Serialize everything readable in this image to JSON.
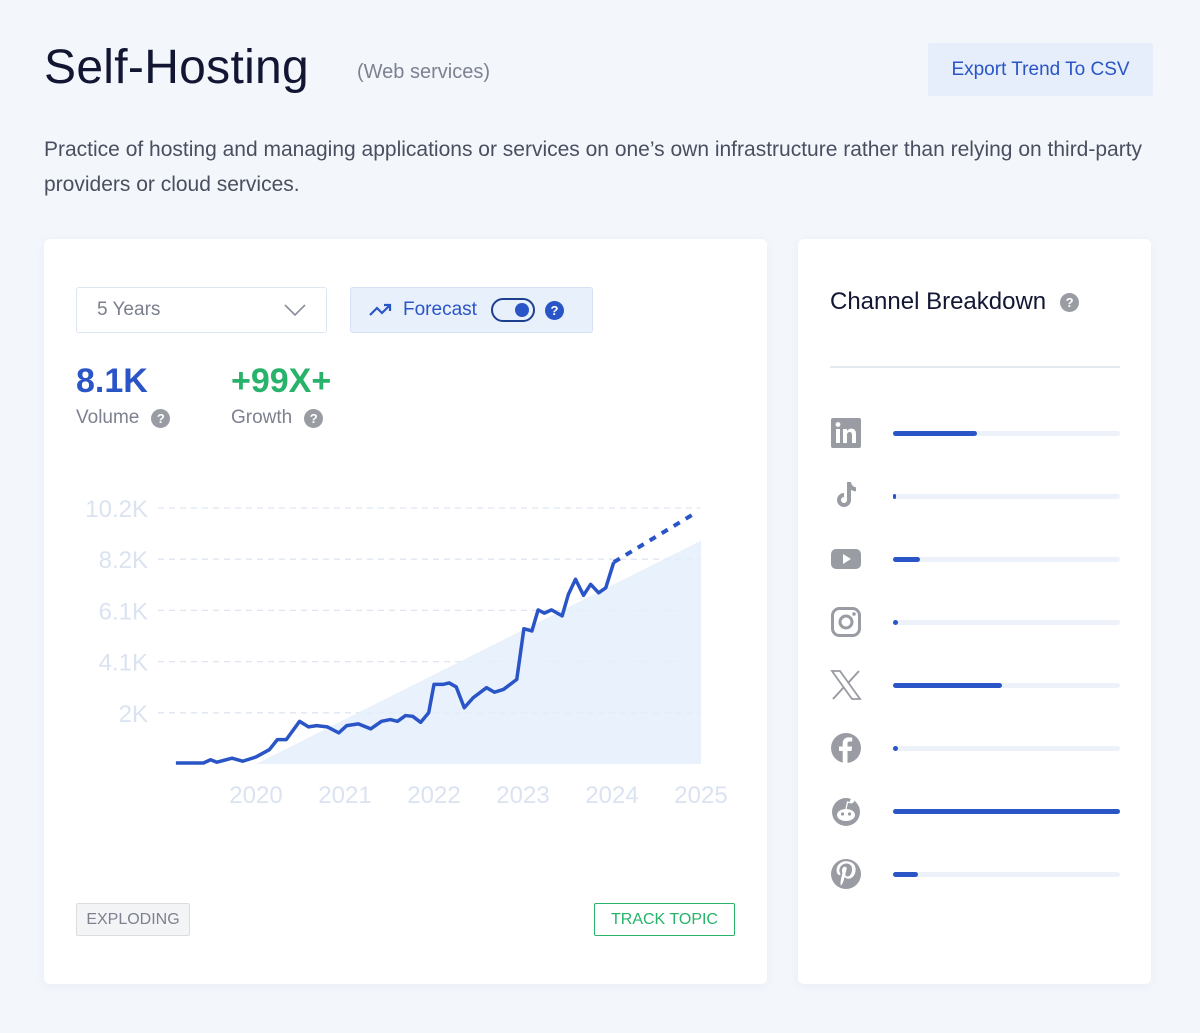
{
  "header": {
    "title": "Self-Hosting",
    "category": "(Web services)",
    "export_label": "Export Trend To CSV",
    "description": "Practice of hosting and managing applications or services on one’s own infrastructure rather than relying on third-party providers or cloud services."
  },
  "controls": {
    "range_value": "5 Years",
    "forecast_label": "Forecast",
    "forecast_on": true
  },
  "metrics": {
    "volume_value": "8.1K",
    "volume_label": "Volume",
    "growth_value": "+99X+",
    "growth_label": "Growth"
  },
  "badges": {
    "status": "EXPLODING",
    "track_label": "TRACK TOPIC"
  },
  "colors": {
    "accent": "#2a55c6",
    "growth": "#27b36a",
    "trend_fill": "#e4eefb"
  },
  "chart_data": {
    "type": "line",
    "x_ticks": [
      "2020",
      "2021",
      "2022",
      "2023",
      "2024",
      "2025"
    ],
    "y_ticks": [
      {
        "value": 2040,
        "label": "2K"
      },
      {
        "value": 4080,
        "label": "4.1K"
      },
      {
        "value": 6120,
        "label": "6.1K"
      },
      {
        "value": 8160,
        "label": "8.2K"
      },
      {
        "value": 10200,
        "label": "10.2K"
      }
    ],
    "xlim": [
      2019.1,
      2025
    ],
    "ylim": [
      0,
      10200
    ],
    "grid": "horizontal-dashed",
    "series": [
      {
        "style": "solid",
        "points": [
          [
            2019.1,
            40
          ],
          [
            2019.41,
            40
          ],
          [
            2019.49,
            170
          ],
          [
            2019.56,
            70
          ],
          [
            2019.73,
            230
          ],
          [
            2019.85,
            110
          ],
          [
            2020.0,
            280
          ],
          [
            2020.15,
            570
          ],
          [
            2020.24,
            970
          ],
          [
            2020.34,
            970
          ],
          [
            2020.49,
            1700
          ],
          [
            2020.59,
            1480
          ],
          [
            2020.68,
            1530
          ],
          [
            2020.8,
            1480
          ],
          [
            2020.93,
            1240
          ],
          [
            2021.02,
            1530
          ],
          [
            2021.15,
            1600
          ],
          [
            2021.29,
            1400
          ],
          [
            2021.41,
            1700
          ],
          [
            2021.51,
            1770
          ],
          [
            2021.59,
            1700
          ],
          [
            2021.68,
            1930
          ],
          [
            2021.76,
            1900
          ],
          [
            2021.85,
            1660
          ],
          [
            2021.94,
            2040
          ],
          [
            2022.0,
            3170
          ],
          [
            2022.1,
            3170
          ],
          [
            2022.17,
            3230
          ],
          [
            2022.25,
            3070
          ],
          [
            2022.34,
            2240
          ],
          [
            2022.44,
            2640
          ],
          [
            2022.59,
            3040
          ],
          [
            2022.68,
            2860
          ],
          [
            2022.78,
            2970
          ],
          [
            2022.93,
            3370
          ],
          [
            2023.01,
            5390
          ],
          [
            2023.1,
            5300
          ],
          [
            2023.17,
            6140
          ],
          [
            2023.24,
            6010
          ],
          [
            2023.32,
            6140
          ],
          [
            2023.44,
            5900
          ],
          [
            2023.51,
            6760
          ],
          [
            2023.59,
            7360
          ],
          [
            2023.68,
            6720
          ],
          [
            2023.76,
            7160
          ],
          [
            2023.85,
            6820
          ],
          [
            2023.93,
            7020
          ],
          [
            2024.02,
            8040
          ]
        ]
      },
      {
        "style": "dotted-forecast",
        "points": [
          [
            2024.02,
            8040
          ],
          [
            2024.95,
            10030
          ]
        ]
      },
      {
        "style": "trend-area",
        "points": [
          [
            2020.0,
            0
          ],
          [
            2025.0,
            8900
          ]
        ]
      }
    ]
  },
  "channels": {
    "title": "Channel Breakdown",
    "items": [
      {
        "name": "LinkedIn",
        "icon": "linkedin-icon",
        "share": 37
      },
      {
        "name": "TikTok",
        "icon": "tiktok-icon",
        "share": 1
      },
      {
        "name": "YouTube",
        "icon": "youtube-icon",
        "share": 12
      },
      {
        "name": "Instagram",
        "icon": "instagram-icon",
        "share": 2
      },
      {
        "name": "X",
        "icon": "x-icon",
        "share": 48
      },
      {
        "name": "Facebook",
        "icon": "facebook-icon",
        "share": 2
      },
      {
        "name": "Reddit",
        "icon": "reddit-icon",
        "share": 100
      },
      {
        "name": "Pinterest",
        "icon": "pinterest-icon",
        "share": 11
      }
    ]
  }
}
